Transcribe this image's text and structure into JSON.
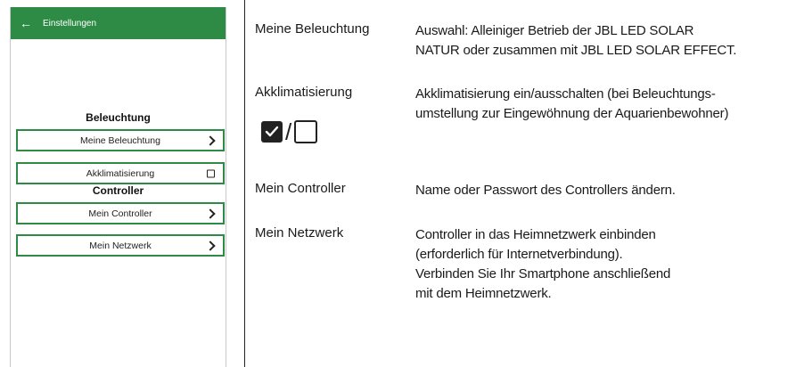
{
  "phone": {
    "header_title": "Einstellungen",
    "sections": {
      "lighting_title": "Beleuchtung",
      "controller_title": "Controller"
    },
    "items": [
      {
        "label": "Meine Beleuchtung",
        "control": "chevron-right-icon"
      },
      {
        "label": "Akklimatisierung",
        "control": "checkbox-unchecked-icon"
      },
      {
        "label": "Mein Controller",
        "control": "chevron-right-icon"
      },
      {
        "label": "Mein Netzwerk",
        "control": "chevron-right-icon"
      }
    ],
    "accent_color": "#2e8b46"
  },
  "descriptions": [
    {
      "term": "Meine Beleuchtung",
      "text": "Auswahl: Alleiniger Betrieb der JBL LED SOLAR\nNATUR oder zusammen mit JBL LED SOLAR EFFECT."
    },
    {
      "term": "Akklimatisierung",
      "text": "Akklimatisierung ein/ausschalten (bei Beleuchtungs-\numstellung zur Eingewöhnung der Aquarienbewohner)"
    },
    {
      "term": "Mein Controller",
      "text": "Name oder Passwort des Controllers ändern."
    },
    {
      "term": "Mein Netzwerk",
      "text": "Controller in das Heimnetzwerk einbinden\n(erforderlich für Internetverbindung).\nVerbinden Sie Ihr Smartphone anschließend\nmit dem Heimnetzwerk."
    }
  ],
  "checkbox_legend": {
    "separator": "/",
    "checked_icon": "checkbox-checked-icon",
    "unchecked_icon": "checkbox-unchecked-icon"
  }
}
